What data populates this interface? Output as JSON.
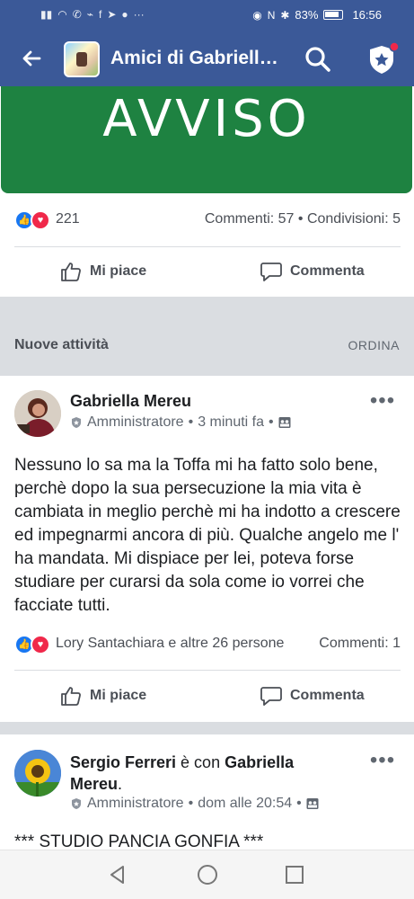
{
  "status_bar": {
    "battery": "83%",
    "time": "16:56"
  },
  "app_bar": {
    "title": "Amici di Gabriella...",
    "back_icon": "arrow-left-icon",
    "search_icon": "search-icon",
    "admin_icon": "shield-star-icon"
  },
  "banner": {
    "text": "AVVISO",
    "color": "#1e8241"
  },
  "post1_stats": {
    "reaction_count": "221",
    "comments_shares": "Commenti: 57 • Condivisioni: 5"
  },
  "actions": {
    "like_label": "Mi piace",
    "comment_label": "Commenta"
  },
  "feed_header": {
    "title": "Nuove attività",
    "sort_label": "ORDINA"
  },
  "post2": {
    "author": "Gabriella Mereu",
    "role": "Amministratore",
    "time": "3 minuti fa",
    "body": "Nessuno lo sa ma la Toffa mi ha fatto solo bene, perchè dopo la sua persecuzione la mia vita è cambiata in meglio perchè mi  ha indotto a crescere ed impegnarmi ancora di più. Qualche angelo me l' ha mandata. Mi dispiace per lei, poteva forse studiare per curarsi da sola come io vorrei che facciate tutti.",
    "reactors": "Lory Santachiara e altre 26 persone",
    "comments": "Commenti: 1"
  },
  "post3": {
    "author": "Sergio Ferreri",
    "with_text": " è con ",
    "tagged_first": "Gabriella",
    "tagged_second": "Mereu",
    "period": ".",
    "role": "Amministratore",
    "time": "dom alle 20:54",
    "body": "*** STUDIO PANCIA GONFIA ***"
  },
  "colors": {
    "facebook_blue": "#3b5998",
    "like_blue": "#1877f2",
    "love_red": "#f0284a",
    "notification_red": "#f02849"
  }
}
